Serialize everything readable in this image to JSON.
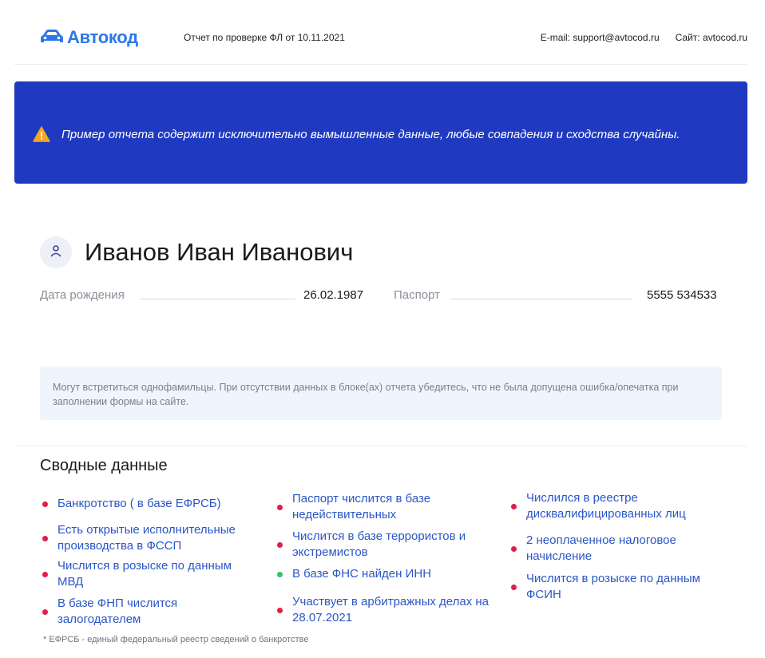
{
  "header": {
    "logo_text": "Автокод",
    "report_title": "Отчет по проверке ФЛ от 10.11.2021",
    "email": "E-mail: support@avtocod.ru",
    "site": "Сайт: avtocod.ru"
  },
  "banner": {
    "text": "Пример отчета содержит исключительно вымышленные данные, любые совпадения и сходства случайны."
  },
  "person": {
    "name": "Иванов Иван Иванович",
    "birth_label": "Дата рождения",
    "birth_value": "26.02.1987",
    "passport_label": "Паспорт",
    "passport_value": "5555 534533"
  },
  "note": {
    "text": "Могут встретиться однофамильцы. При отсутствии данных в блоке(ах) отчета убедитесь, что не была допущена ошибка/опечатка при заполнении формы на сайте."
  },
  "summary": {
    "title": "Сводные данные",
    "col1": [
      {
        "text": "Банкротство ( в базе ЕФРСБ)",
        "status": "red"
      },
      {
        "text": "Есть открытые исполнительные производства в ФССП",
        "status": "red"
      },
      {
        "text": "Числится в розыске по данным МВД",
        "status": "red"
      },
      {
        "text": "В базе ФНП числится залогодателем",
        "status": "red"
      }
    ],
    "col2": [
      {
        "text": "Паспорт числится в базе недействительных",
        "status": "red"
      },
      {
        "text": "Числится в базе террористов и экстремистов",
        "status": "red"
      },
      {
        "text": "В базе ФНС найден ИНН",
        "status": "green"
      },
      {
        "text": "Участвует в арбитражных делах на 28.07.2021",
        "status": "red"
      }
    ],
    "col3": [
      {
        "text": "Числился в реестре дисквалифицированных лиц",
        "status": "red"
      },
      {
        "text": "2 неоплаченное налоговое начисление",
        "status": "red"
      },
      {
        "text": "Числится в розыске по данным ФСИН",
        "status": "red"
      }
    ],
    "footnote": "* ЕФРСБ - единый федеральный реестр сведений о банкротстве"
  },
  "colors": {
    "accent": "#2b77e8",
    "banner": "#1f3ac0",
    "link": "#2b56c6",
    "status_red": "#e01e4a",
    "status_green": "#2ec26b"
  }
}
